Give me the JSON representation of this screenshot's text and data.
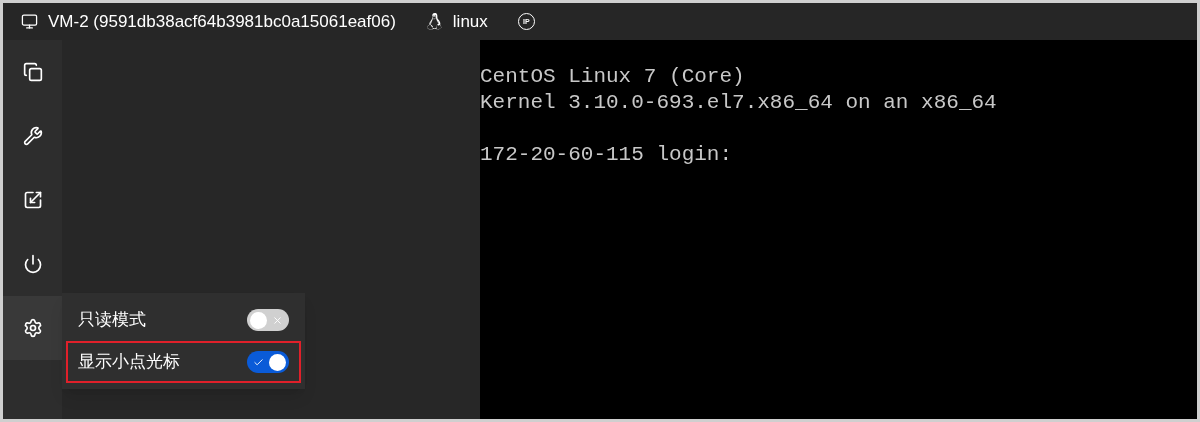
{
  "header": {
    "vm_title": "VM-2 (9591db38acf64b3981bc0a15061eaf06)",
    "os": "linux",
    "ip_badge": "IP"
  },
  "sidebar": {
    "items": [
      {
        "kind": "copy",
        "selected": false
      },
      {
        "kind": "tools",
        "selected": false
      },
      {
        "kind": "resize",
        "selected": false
      },
      {
        "kind": "power",
        "selected": false
      },
      {
        "kind": "settings",
        "selected": true
      }
    ]
  },
  "settings_menu": {
    "options": [
      {
        "label": "只读模式",
        "on": false,
        "highlighted": false
      },
      {
        "label": "显示小点光标",
        "on": true,
        "highlighted": true
      }
    ]
  },
  "terminal": {
    "blocks": [
      [
        "CentOS Linux 7 (Core)",
        "Kernel 3.10.0-693.el7.x86_64 on an x86_64"
      ],
      [
        "172-20-60-115 login:"
      ]
    ]
  }
}
